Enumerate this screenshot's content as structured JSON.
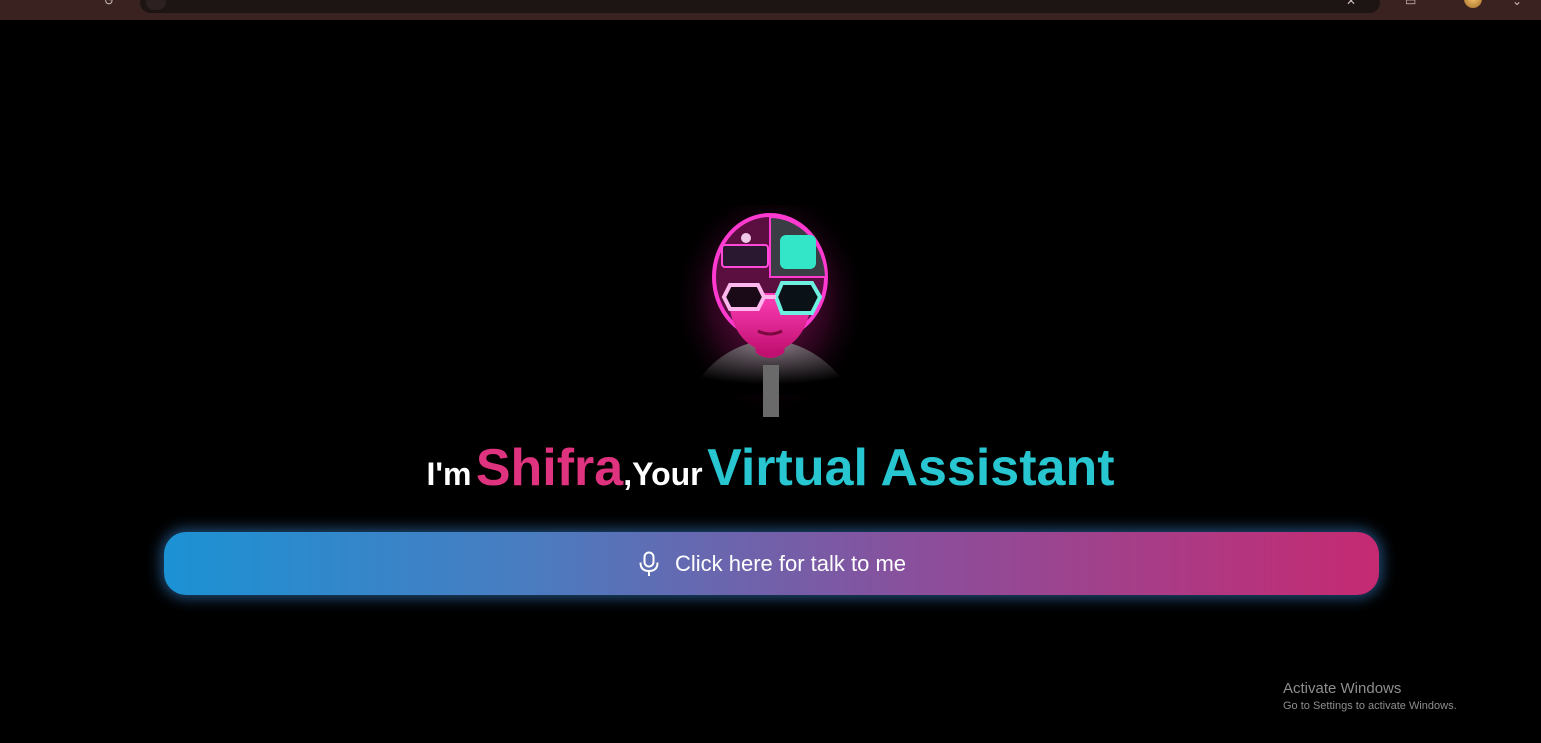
{
  "browser": {
    "icons": [
      "back-arrow-icon",
      "close-icon",
      "extensions-icon",
      "profile-avatar-icon",
      "menu-icon"
    ]
  },
  "hero": {
    "avatar_icon": "neon-robot-avatar-icon",
    "intro_prefix": "I'm",
    "assistant_name": "Shifra",
    "intro_middle": ",Your",
    "assistant_role": "Virtual Assistant"
  },
  "talk_button": {
    "label": "Click here for talk to me",
    "icon": "microphone-icon"
  },
  "watermark": {
    "title": "Activate Windows",
    "subtitle": "Go to Settings to activate Windows."
  },
  "colors": {
    "background": "#000000",
    "name_accent": "#e0337f",
    "role_accent": "#27c6d0",
    "button_gradient_start": "#1b92d4",
    "button_gradient_end": "#c52a72"
  }
}
